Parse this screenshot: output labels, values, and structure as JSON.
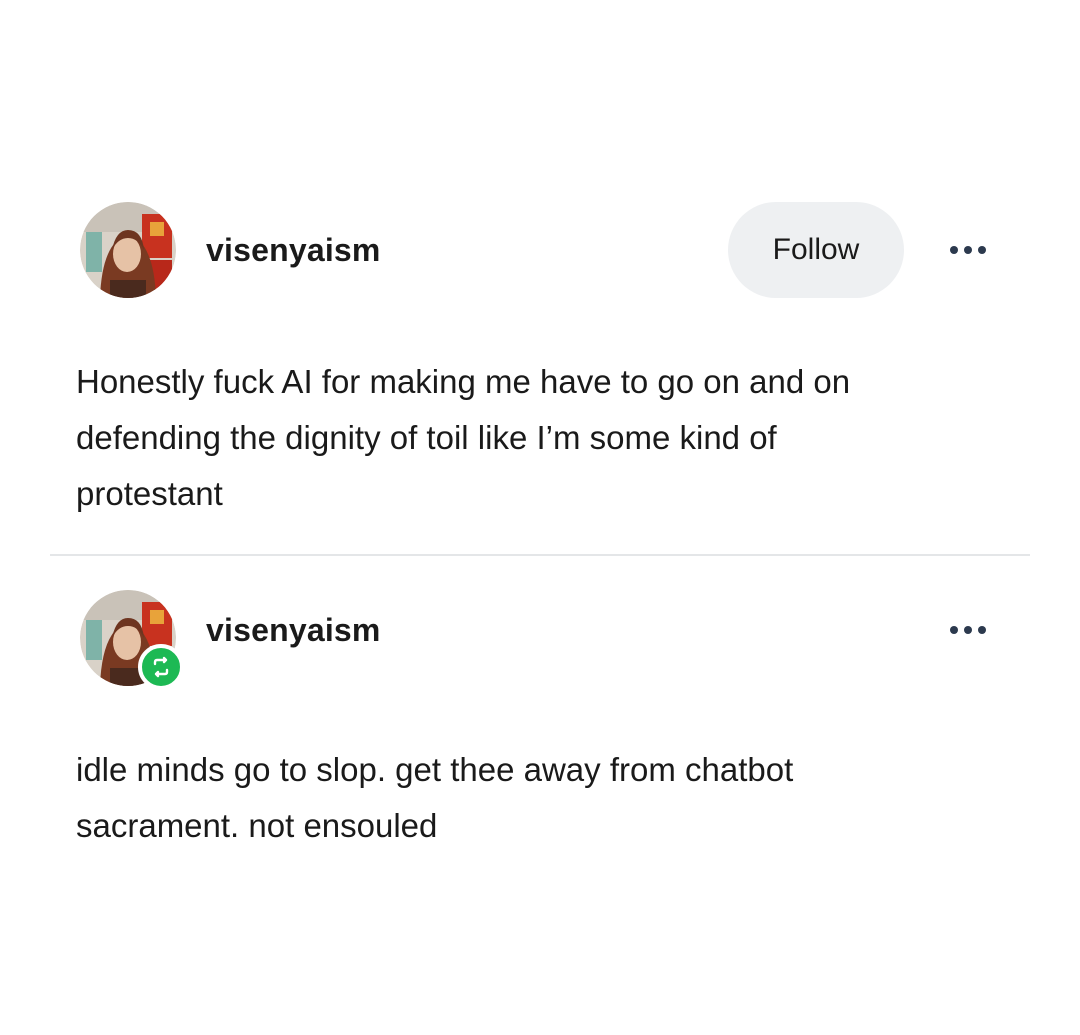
{
  "post": {
    "author": {
      "username": "visenyaism"
    },
    "follow_label": "Follow",
    "more_icon": "more-horizontal-icon",
    "text_lines": [
      "Honestly fuck AI for making me have to go on and on",
      "defending the dignity of toil like I’m some kind of",
      "protestant"
    ]
  },
  "reblog": {
    "author": {
      "username": "visenyaism"
    },
    "badge_icon": "reblog-icon",
    "badge_color": "#1db954",
    "more_icon": "more-horizontal-icon",
    "text_lines": [
      "idle minds go to slop. get thee away from chatbot",
      "sacrament. not ensouled"
    ]
  }
}
